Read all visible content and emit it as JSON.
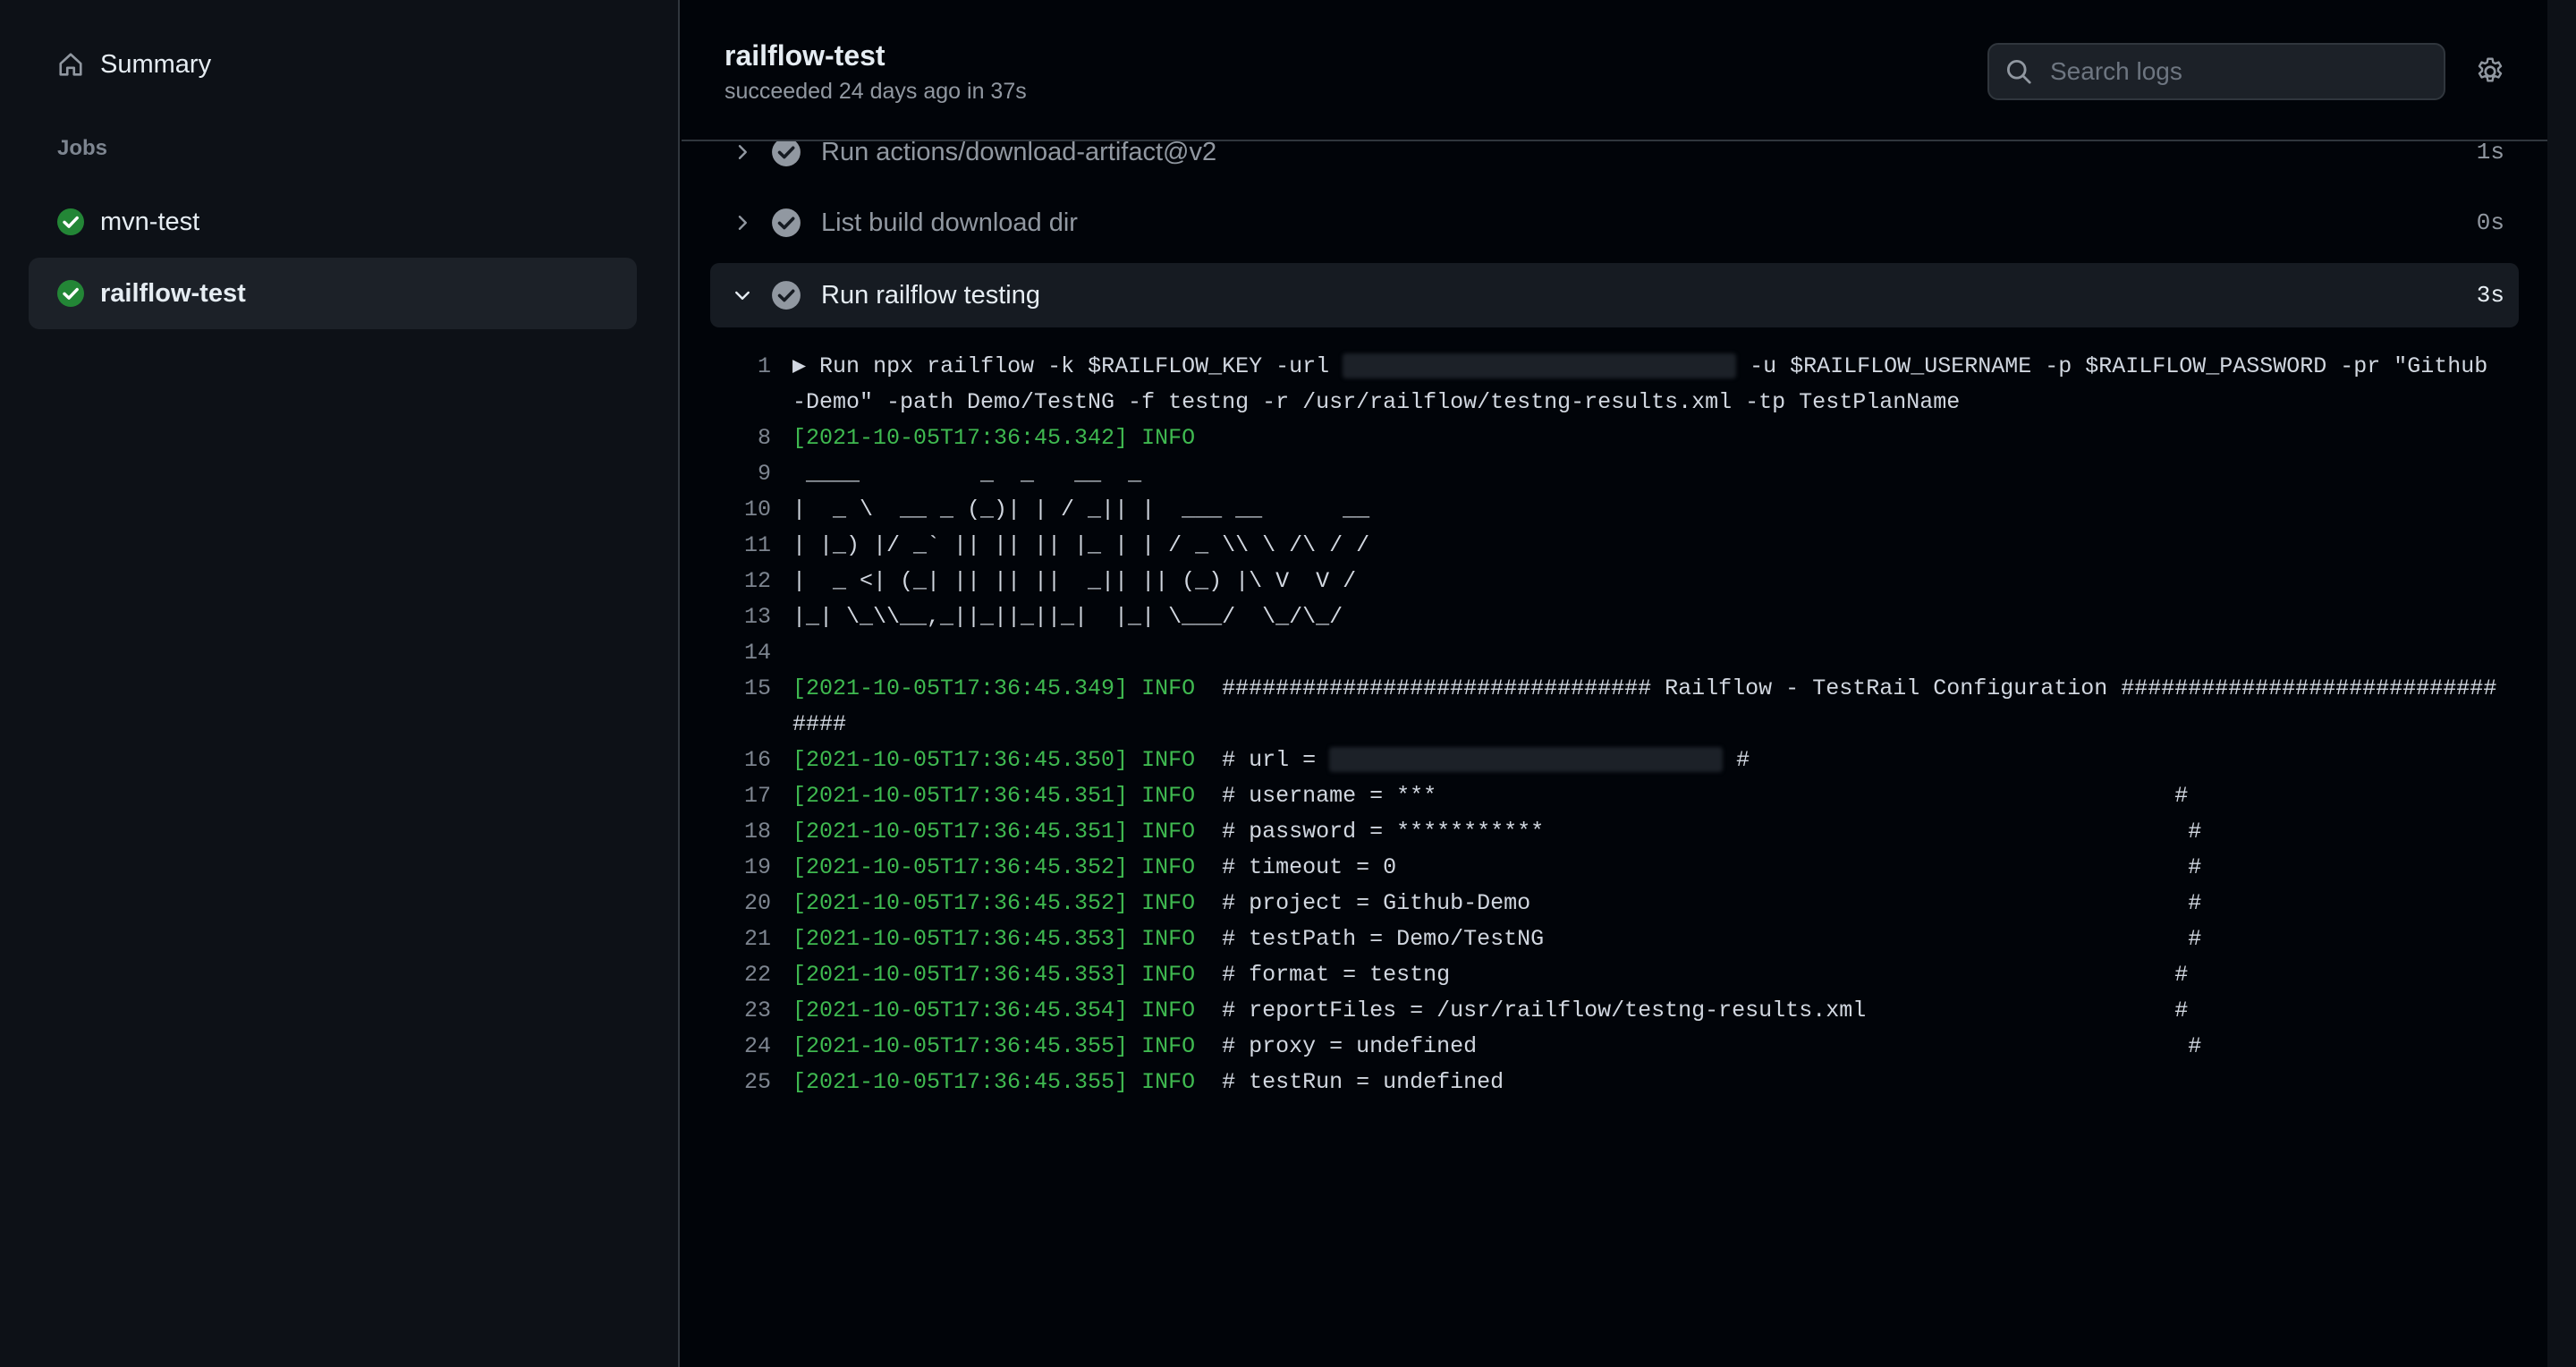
{
  "sidebar": {
    "summary_label": "Summary",
    "jobs_label": "Jobs",
    "jobs": [
      {
        "label": "mvn-test",
        "status": "success"
      },
      {
        "label": "railflow-test",
        "status": "success"
      }
    ]
  },
  "header": {
    "title": "railflow-test",
    "subtitle": "succeeded 24 days ago in 37s",
    "search_placeholder": "Search logs"
  },
  "steps": [
    {
      "name": "Run actions/download-artifact@v2",
      "duration": "1s"
    },
    {
      "name": "List build download dir",
      "duration": "0s"
    },
    {
      "name": "Run railflow testing",
      "duration": "3s"
    }
  ],
  "log": {
    "l1": {
      "n": "1",
      "a": "▶ Run npx railflow -k $RAILFLOW_KEY -url ",
      "b": " -u $RAILFLOW_USERNAME -p $RAILFLOW_PASSWORD -pr \"Github-Demo\" -path Demo/TestNG -f testng -r /usr/railflow/testng-results.xml -tp TestPlanName"
    },
    "l8": {
      "n": "8",
      "ts": "[2021-10-05T17:36:45.342] INFO",
      "t": ""
    },
    "art": [
      {
        "n": "9",
        "t": " ____         _  _   __  _"
      },
      {
        "n": "10",
        "t": "|  _ \\  __ _ (_)| | / _|| |  ___ __      __"
      },
      {
        "n": "11",
        "t": "| |_) |/ _` || || || |_ | | / _ \\\\ \\ /\\ / /"
      },
      {
        "n": "12",
        "t": "|  _ <| (_| || || ||  _|| || (_) |\\ V  V /"
      },
      {
        "n": "13",
        "t": "|_| \\_\\\\__,_||_||_||_|  |_| \\___/  \\_/\\_/"
      },
      {
        "n": "14",
        "t": ""
      }
    ],
    "l15": {
      "n": "15",
      "ts": "[2021-10-05T17:36:45.349] INFO",
      "t": "  ################################ Railflow - TestRail Configuration ################################"
    },
    "l16": {
      "n": "16",
      "ts": "[2021-10-05T17:36:45.350] INFO",
      "a": "  # url = ",
      "b": " #"
    },
    "l17": {
      "n": "17",
      "ts": "[2021-10-05T17:36:45.351] INFO",
      "t": "  # username = ***                                                       #"
    },
    "entries": [
      {
        "n": "18",
        "ts": "[2021-10-05T17:36:45.351] INFO",
        "t": "  # password = ***********                                                #"
      },
      {
        "n": "19",
        "ts": "[2021-10-05T17:36:45.352] INFO",
        "t": "  # timeout = 0                                                           #"
      },
      {
        "n": "20",
        "ts": "[2021-10-05T17:36:45.352] INFO",
        "t": "  # project = Github-Demo                                                 #"
      },
      {
        "n": "21",
        "ts": "[2021-10-05T17:36:45.353] INFO",
        "t": "  # testPath = Demo/TestNG                                                #"
      },
      {
        "n": "22",
        "ts": "[2021-10-05T17:36:45.353] INFO",
        "t": "  # format = testng                                                      #"
      },
      {
        "n": "23",
        "ts": "[2021-10-05T17:36:45.354] INFO",
        "t": "  # reportFiles = /usr/railflow/testng-results.xml                       #"
      },
      {
        "n": "24",
        "ts": "[2021-10-05T17:36:45.355] INFO",
        "t": "  # proxy = undefined                                                     #"
      },
      {
        "n": "25",
        "ts": "[2021-10-05T17:36:45.355] INFO",
        "t": "  # testRun = undefined"
      }
    ]
  }
}
